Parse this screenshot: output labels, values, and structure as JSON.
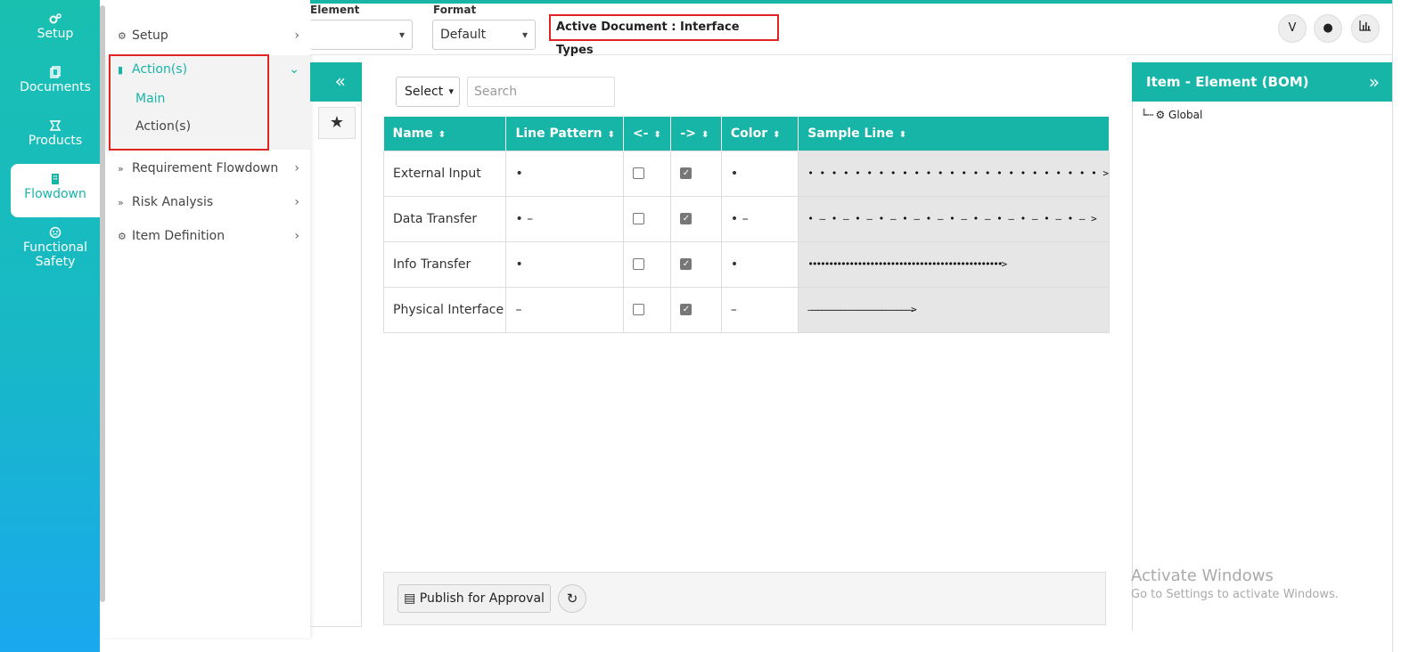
{
  "rail": {
    "items": [
      {
        "label": "Setup",
        "icon": "gears-icon"
      },
      {
        "label": "Documents",
        "icon": "documents-icon"
      },
      {
        "label": "Products",
        "icon": "products-icon"
      },
      {
        "label": "Flowdown",
        "icon": "building-icon"
      },
      {
        "label": "Functional Safety",
        "icon": "safety-icon"
      }
    ],
    "functional_line1": "Functional",
    "functional_line2": "Safety"
  },
  "menu": {
    "setup": "Setup",
    "actions": "Action(s)",
    "sub_main": "Main",
    "sub_actions": "Action(s)",
    "requirement_flowdown": "Requirement Flowdown",
    "risk_analysis": "Risk Analysis",
    "item_definition": "Item Definition"
  },
  "topbar": {
    "element_label": "Element",
    "format_label": "Format",
    "format_value": "Default",
    "active_document": "Active Document : Interface Types"
  },
  "filter": {
    "select_value": "Select",
    "search_placeholder": "Search"
  },
  "table": {
    "headers": [
      "Name",
      "Line Pattern",
      "<-",
      "->",
      "Color",
      "Sample Line"
    ],
    "rows": [
      {
        "name": "External Input",
        "pattern": "•",
        "left": false,
        "right": true,
        "color": "•",
        "sample": "• • • • • • • • • • • • • • • • • • • • • • • • • >"
      },
      {
        "name": "Data Transfer",
        "pattern": "• –",
        "left": false,
        "right": true,
        "color": "• –",
        "sample": "• – • – • – • – • – • – • – • – • – • – • – • – >"
      },
      {
        "name": "Info Transfer",
        "pattern": "•",
        "left": false,
        "right": true,
        "color": "•",
        "sample": "•••••••••••••••••••••••••••••••••••••••••••••••>"
      },
      {
        "name": "Physical Interface",
        "pattern": "–",
        "left": false,
        "right": true,
        "color": "–",
        "sample": "––––––––––––––––––––––––––––––––>"
      }
    ]
  },
  "footer": {
    "publish_label": "Publish for Approval"
  },
  "right_panel": {
    "title": "Item - Element (BOM)",
    "tree_root": "Global"
  },
  "watermark": {
    "line1": "Activate Windows",
    "line2": "Go to Settings to activate Windows."
  },
  "colors": {
    "accent": "#17b5a8",
    "highlight_border": "#e02424"
  }
}
